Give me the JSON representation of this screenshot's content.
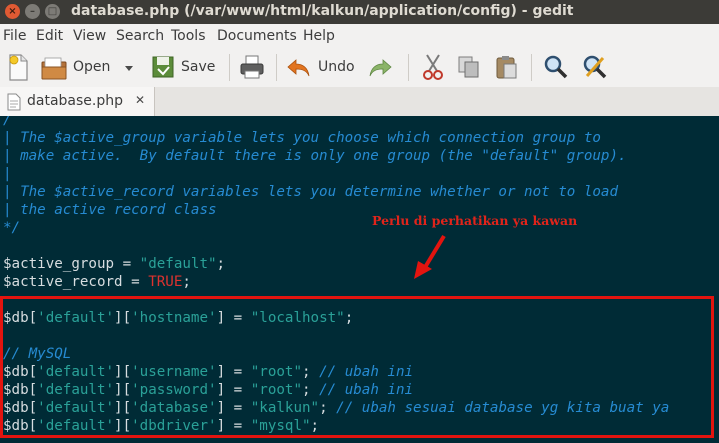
{
  "window": {
    "title": "database.php (/var/www/html/kalkun/application/config) - gedit",
    "close_glyph": "×",
    "min_glyph": "–",
    "max_glyph": "□"
  },
  "menubar": {
    "items": [
      "File",
      "Edit",
      "View",
      "Search",
      "Tools",
      "Documents",
      "Help"
    ]
  },
  "toolbar": {
    "open_label": "Open",
    "save_label": "Save",
    "undo_label": "Undo",
    "icons": [
      "new-document-icon",
      "open-icon",
      "dropdown-icon",
      "save-icon",
      "print-icon",
      "undo-icon",
      "redo-icon",
      "cut-icon",
      "copy-icon",
      "paste-icon",
      "find-icon",
      "find-replace-icon"
    ]
  },
  "tab": {
    "label": "database.php",
    "close_glyph": "✕"
  },
  "editor": {
    "lines": [
      {
        "parts": [
          {
            "t": "/",
            "c": "c"
          }
        ]
      },
      {
        "parts": [
          {
            "t": "| The $active_group variable lets you choose which connection group to",
            "c": "c"
          }
        ]
      },
      {
        "parts": [
          {
            "t": "| make active.  By default there is only one group (the \"default\" group).",
            "c": "c"
          }
        ]
      },
      {
        "parts": [
          {
            "t": "|",
            "c": "c"
          }
        ]
      },
      {
        "parts": [
          {
            "t": "| The $active_record variables lets you determine whether or not to load",
            "c": "c"
          }
        ]
      },
      {
        "parts": [
          {
            "t": "| the active record class",
            "c": "c"
          }
        ]
      },
      {
        "parts": [
          {
            "t": "*/",
            "c": "c"
          }
        ]
      },
      {
        "parts": []
      },
      {
        "parts": [
          {
            "t": "$active_group = ",
            "c": "d"
          },
          {
            "t": "\"default\"",
            "c": "s"
          },
          {
            "t": ";",
            "c": "d"
          }
        ]
      },
      {
        "parts": [
          {
            "t": "$active_record = ",
            "c": "d"
          },
          {
            "t": "TRUE",
            "c": "k"
          },
          {
            "t": ";",
            "c": "d"
          }
        ]
      },
      {
        "parts": []
      },
      {
        "parts": [
          {
            "t": "$db[",
            "c": "d"
          },
          {
            "t": "'default'",
            "c": "s"
          },
          {
            "t": "][",
            "c": "d"
          },
          {
            "t": "'hostname'",
            "c": "s"
          },
          {
            "t": "] = ",
            "c": "d"
          },
          {
            "t": "\"localhost\"",
            "c": "s"
          },
          {
            "t": ";",
            "c": "d"
          }
        ]
      },
      {
        "parts": []
      },
      {
        "parts": [
          {
            "t": "// MySQL",
            "c": "c"
          }
        ]
      },
      {
        "parts": [
          {
            "t": "$db[",
            "c": "d"
          },
          {
            "t": "'default'",
            "c": "s"
          },
          {
            "t": "][",
            "c": "d"
          },
          {
            "t": "'username'",
            "c": "s"
          },
          {
            "t": "] = ",
            "c": "d"
          },
          {
            "t": "\"root\"",
            "c": "s"
          },
          {
            "t": "; ",
            "c": "d"
          },
          {
            "t": "// ubah ini",
            "c": "c"
          }
        ]
      },
      {
        "parts": [
          {
            "t": "$db[",
            "c": "d"
          },
          {
            "t": "'default'",
            "c": "s"
          },
          {
            "t": "][",
            "c": "d"
          },
          {
            "t": "'password'",
            "c": "s"
          },
          {
            "t": "] = ",
            "c": "d"
          },
          {
            "t": "\"root\"",
            "c": "s"
          },
          {
            "t": "; ",
            "c": "d"
          },
          {
            "t": "// ubah ini",
            "c": "c"
          }
        ]
      },
      {
        "parts": [
          {
            "t": "$db[",
            "c": "d"
          },
          {
            "t": "'default'",
            "c": "s"
          },
          {
            "t": "][",
            "c": "d"
          },
          {
            "t": "'database'",
            "c": "s"
          },
          {
            "t": "] = ",
            "c": "d"
          },
          {
            "t": "\"kalkun\"",
            "c": "s"
          },
          {
            "t": "; ",
            "c": "d"
          },
          {
            "t": "// ubah sesuai database yg kita buat ya",
            "c": "c"
          }
        ]
      },
      {
        "parts": [
          {
            "t": "$db[",
            "c": "d"
          },
          {
            "t": "'default'",
            "c": "s"
          },
          {
            "t": "][",
            "c": "d"
          },
          {
            "t": "'dbdriver'",
            "c": "s"
          },
          {
            "t": "] = ",
            "c": "d"
          },
          {
            "t": "\"mysql\"",
            "c": "s"
          },
          {
            "t": ";",
            "c": "d"
          }
        ]
      }
    ]
  },
  "annotation": {
    "text": "Perlu di perhatikan ya kawan"
  },
  "colors": {
    "editor_bg": "#002b36",
    "comment": "#268bd2",
    "string": "#2aa198",
    "keyword": "#dc322f",
    "default_text": "#d7dde0",
    "highlight_border": "#e3140f"
  }
}
